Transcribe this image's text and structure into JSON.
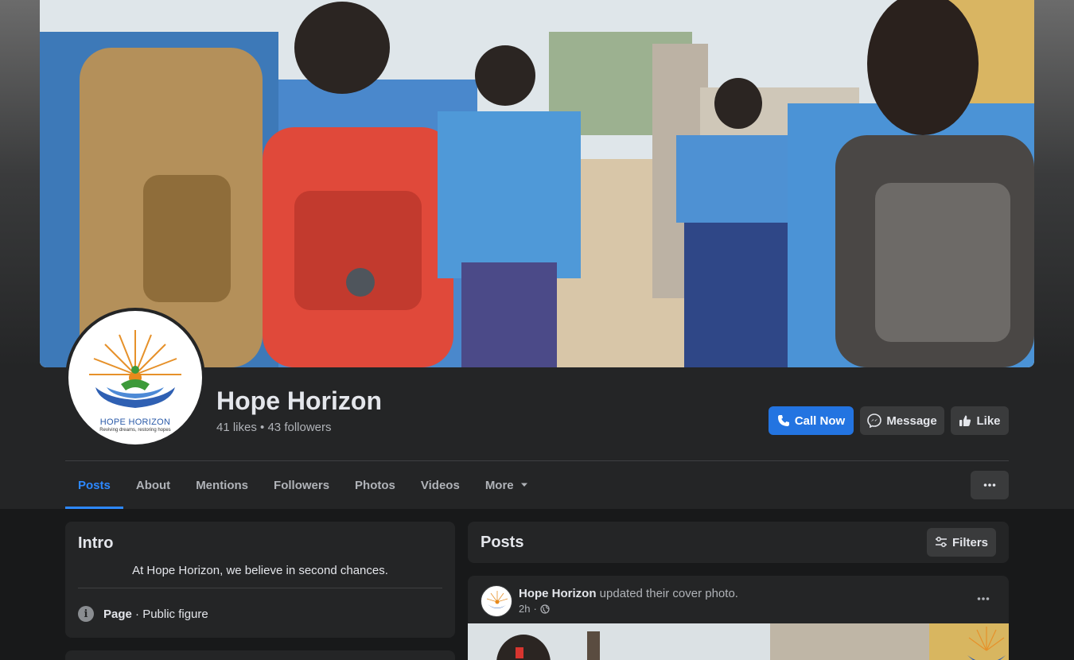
{
  "page": {
    "name": "Hope Horizon",
    "likes": "41 likes",
    "separator": "•",
    "followers": "43 followers"
  },
  "logo": {
    "name": "HOPE HORIZON",
    "tagline": "Reviving dreams, restoring hopes"
  },
  "actions": {
    "call_now": "Call Now",
    "message": "Message",
    "like": "Like"
  },
  "tabs": [
    {
      "label": "Posts",
      "active": true
    },
    {
      "label": "About"
    },
    {
      "label": "Mentions"
    },
    {
      "label": "Followers"
    },
    {
      "label": "Photos"
    },
    {
      "label": "Videos"
    },
    {
      "label": "More"
    }
  ],
  "intro": {
    "title": "Intro",
    "bio": "At Hope Horizon, we believe in second chances.",
    "category_label": "Page",
    "category_value": " · Public figure"
  },
  "posts": {
    "title": "Posts",
    "filters_label": "Filters"
  },
  "post": {
    "author": "Hope Horizon",
    "action": " updated their cover photo.",
    "time": "2h",
    "dot": "·"
  },
  "colors": {
    "accent": "#2d88ff",
    "call_button": "#2374e1",
    "card": "#242526",
    "background": "#18191a"
  },
  "icons": [
    "phone-icon",
    "messenger-icon",
    "thumbs-up-icon",
    "chevron-down-icon",
    "more-dots-icon",
    "info-icon",
    "filters-icon",
    "globe-icon"
  ]
}
